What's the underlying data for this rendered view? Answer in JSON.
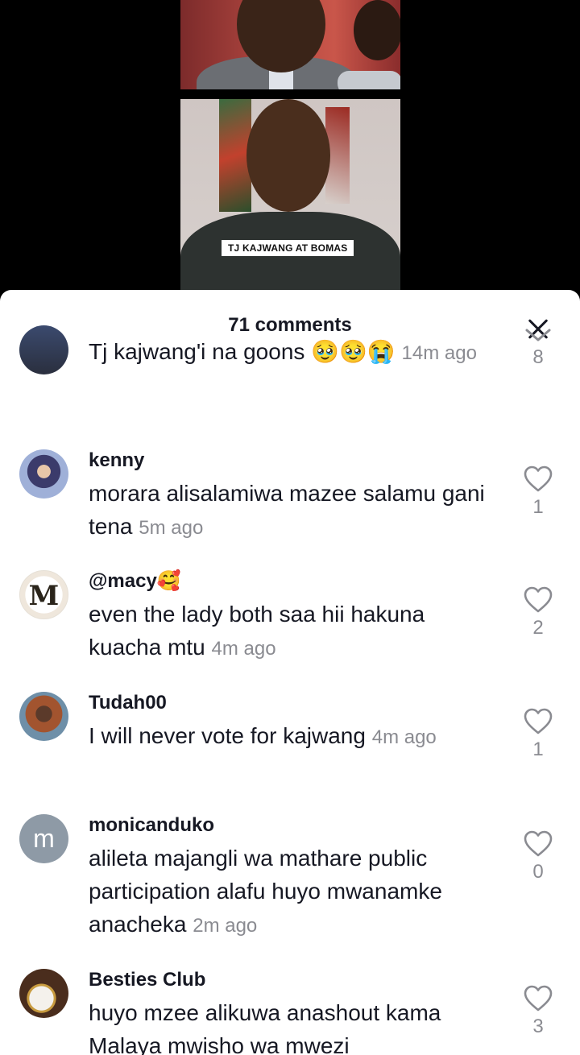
{
  "video": {
    "caption": "TJ KAJWANG AT BOMAS"
  },
  "sheet": {
    "title": "71 comments"
  },
  "comments": [
    {
      "username": "",
      "text": "Tj kajwang'i na goons 🥹🥹😭",
      "time": "14m ago",
      "likes": "8"
    },
    {
      "username": "kenny",
      "text": "morara alisalamiwa mazee salamu gani tena",
      "time": "5m ago",
      "likes": "1"
    },
    {
      "username": "@macy🥰",
      "text": "even the lady both saa hii hakuna kuacha mtu",
      "time": "4m ago",
      "likes": "2"
    },
    {
      "username": "Tudah00",
      "text": "I will never vote for kajwang",
      "time": "4m ago",
      "likes": "1"
    },
    {
      "username": "monicanduko",
      "text": "alileta majangli wa mathare public participation alafu huyo mwanamke anacheka",
      "time": "2m ago",
      "likes": "0"
    },
    {
      "username": "Besties Club",
      "text": "huyo mzee alikuwa anashout kama Malaya mwisho wa mwezi",
      "time": "",
      "likes": "3"
    }
  ],
  "avatars": {
    "macy_monogram": "M",
    "monicanduko_letter": "m"
  },
  "colors": {
    "text_primary": "#161823",
    "text_secondary": "#8a8b91",
    "sheet_bg": "#ffffff",
    "video_bg": "#000000"
  }
}
